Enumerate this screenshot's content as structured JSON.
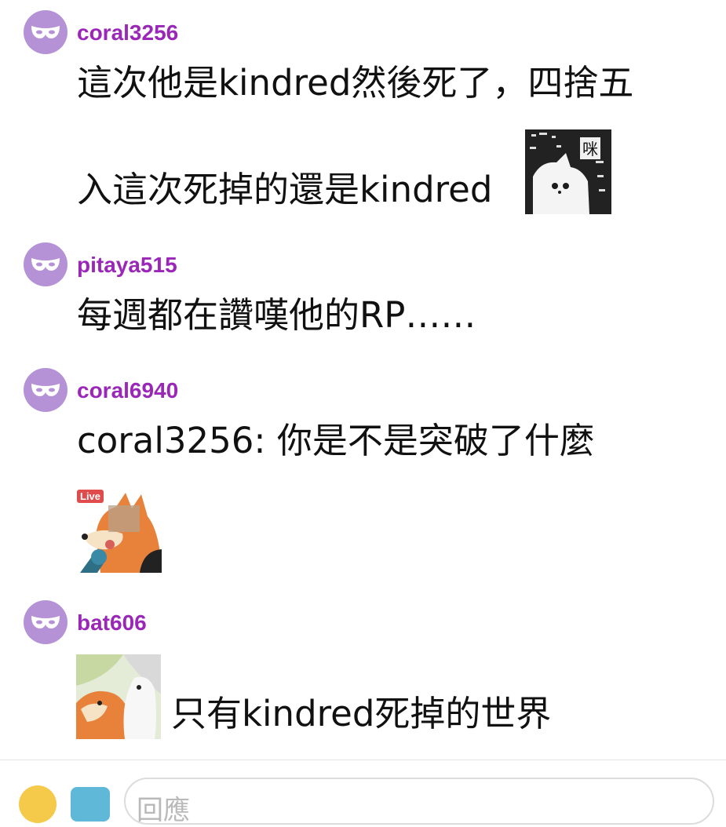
{
  "comments": [
    {
      "username": "coral3256",
      "line1": "這次他是kindred然後死了，四捨五",
      "line2": "入這次死掉的還是kindred",
      "sticker": "white-cat-meow-sticker"
    },
    {
      "username": "pitaya515",
      "line1": "每週都在讚嘆他的RP……"
    },
    {
      "username": "coral6940",
      "line1": "coral3256: 你是不是突破了什麼",
      "sticker": "fox-live-microphone-sticker",
      "sticker_badge": "Live"
    },
    {
      "username": "bat606",
      "line1": "只有kindred死掉的世界",
      "sticker": "fox-shocked-sticker"
    }
  ],
  "footer": {
    "emoji_icon": "emoji-icon",
    "image_icon": "image-icon",
    "reply_placeholder": "回應"
  },
  "colors": {
    "username": "#9a27b8",
    "avatar": "#b592d6",
    "text": "#111111"
  }
}
